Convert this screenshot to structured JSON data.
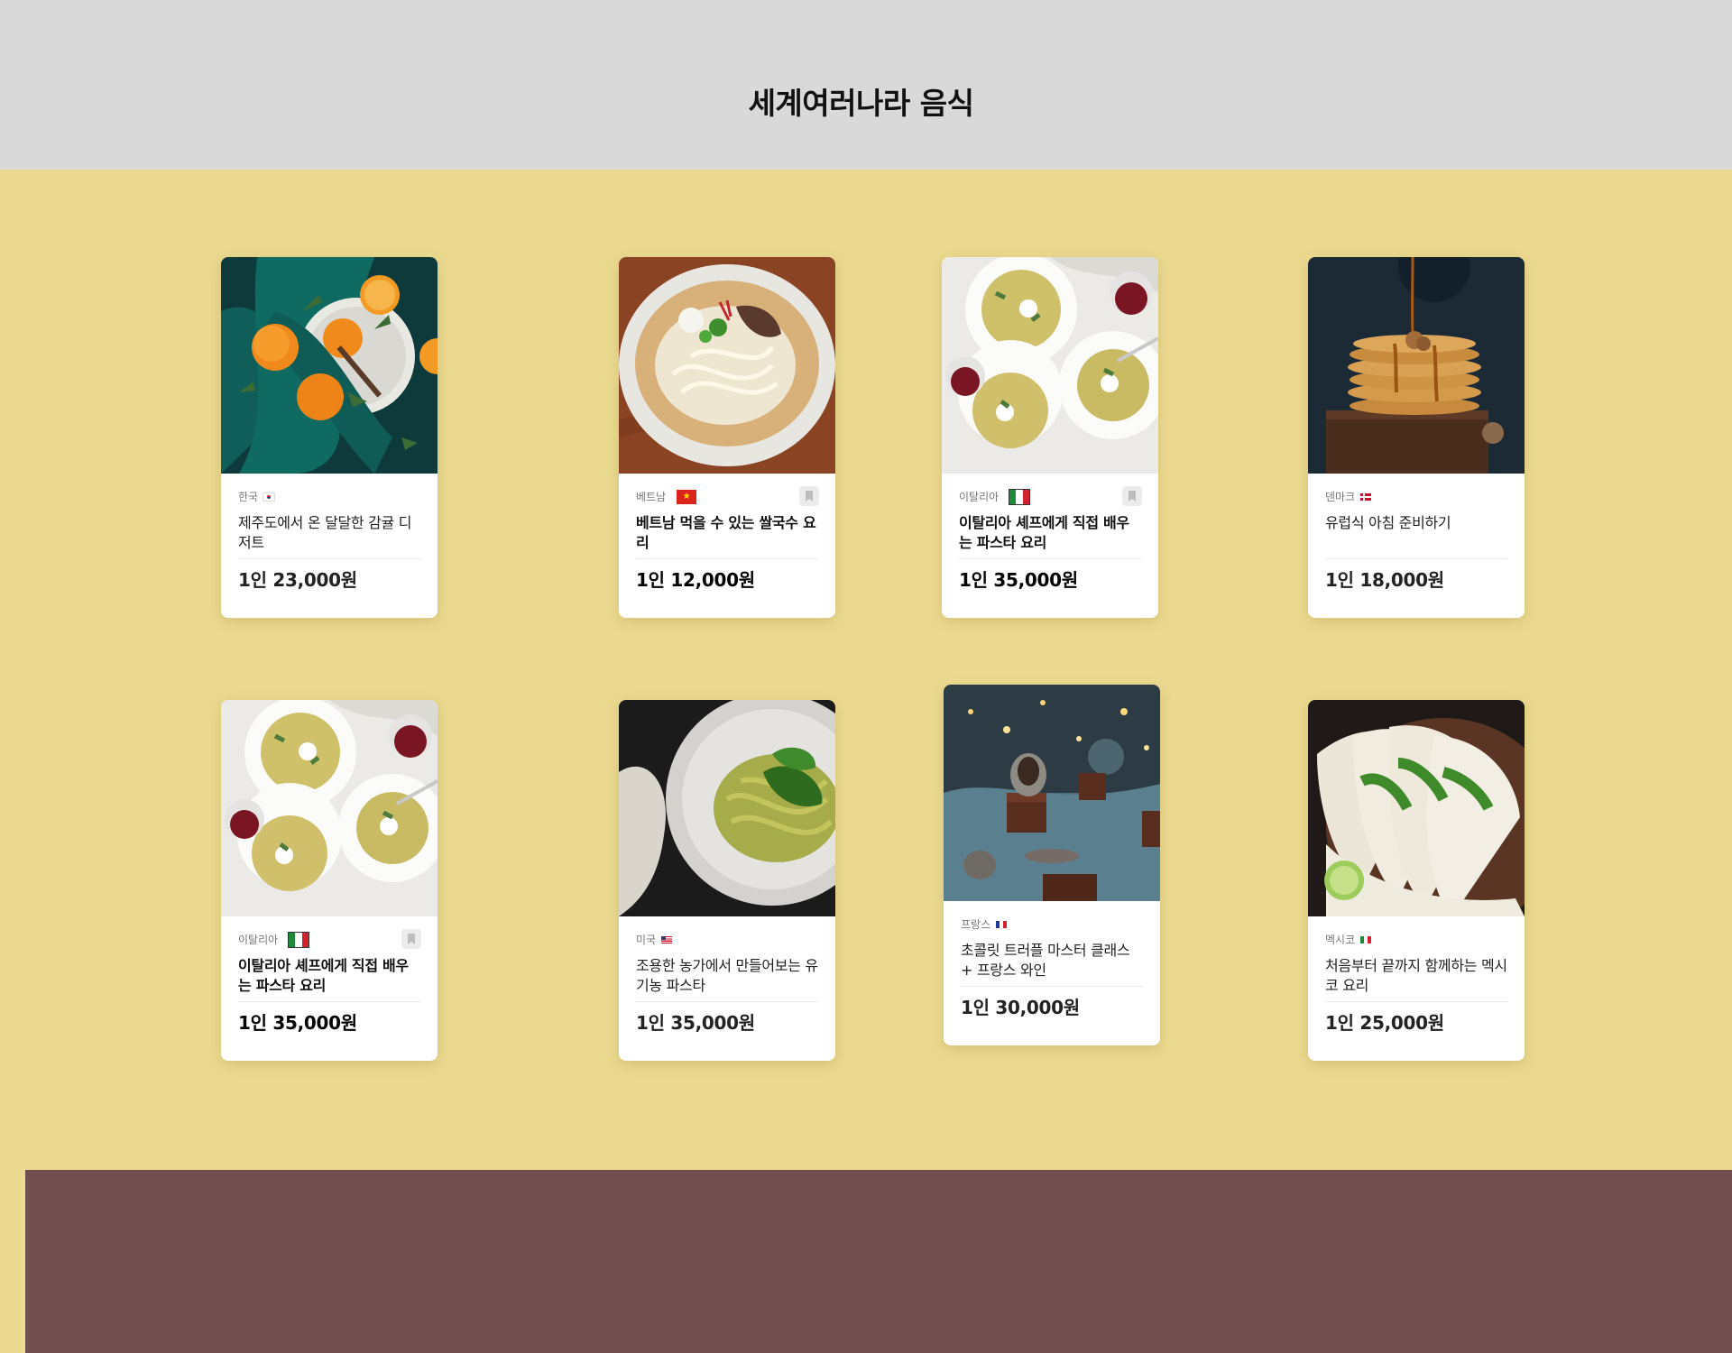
{
  "header": {
    "title": "세계여러나라 음식"
  },
  "colors": {
    "header_bg": "#d9d9d9",
    "page_bg": "#ead98f",
    "footer_bg": "#724f4f"
  },
  "cards": [
    {
      "photo": "citrus-dessert-photo",
      "country": "한국",
      "flag": "korea-flag",
      "title": "제주도에서 온 달달한 감귤 디저트",
      "price": "1인 23,000원",
      "bookmark": false
    },
    {
      "photo": "rice-noodle-soup-photo",
      "country": "베트남",
      "flag": "vietnam-flag",
      "title": "베트남 먹을 수 있는 쌀국수 요리",
      "price": "1인 12,000원",
      "bookmark": true
    },
    {
      "photo": "pasta-plates-photo",
      "country": "이탈리아",
      "flag": "italy-flag",
      "title": "이탈리아 셰프에게 직접 배우는 파스타 요리",
      "price": "1인 35,000원",
      "bookmark": true
    },
    {
      "photo": "pancake-stack-photo",
      "country": "덴마크",
      "flag": "denmark-flag",
      "title": "유럽식 아침 준비하기",
      "price": "1인 18,000원",
      "bookmark": false
    },
    {
      "photo": "pasta-plates-photo",
      "country": "이탈리아",
      "flag": "italy-flag",
      "title": "이탈리아 셰프에게 직접 배우는 파스타 요리",
      "price": "1인 35,000원",
      "bookmark": true
    },
    {
      "photo": "pesto-pasta-photo",
      "country": "미국",
      "flag": "usa-flag",
      "title": "조용한 농가에서 만들어보는 유기농 파스타",
      "price": "1인 35,000원",
      "bookmark": false
    },
    {
      "photo": "chocolate-truffle-photo",
      "country": "프랑스",
      "flag": "france-flag",
      "title": "초콜릿 트러플 마스터 클래스 + 프랑스 와인",
      "price": "1인 30,000원",
      "bookmark": false
    },
    {
      "photo": "tacos-photo",
      "country": "멕시코",
      "flag": "mexico-flag",
      "title": "처음부터 끝까지 함께하는 멕시코 요리",
      "price": "1인 25,000원",
      "bookmark": false
    }
  ]
}
